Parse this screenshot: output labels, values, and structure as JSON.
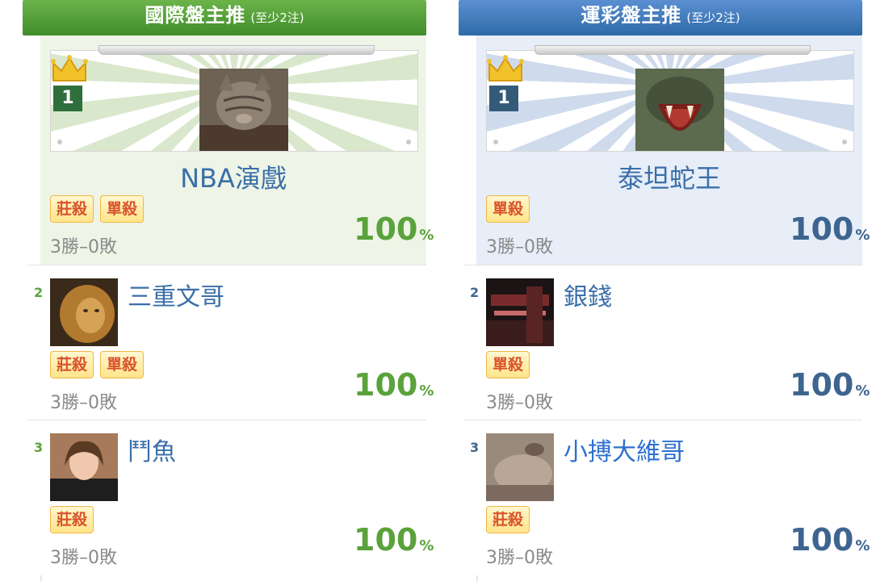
{
  "left": {
    "header": {
      "title": "國際盤主推",
      "sub": "(至少2注)"
    },
    "top": {
      "rank": "1",
      "name": "NBA演戲",
      "badges": [
        "莊殺",
        "單殺"
      ],
      "record": "3勝–0敗",
      "pct": "100",
      "pct_unit": "%"
    },
    "rows": [
      {
        "rank": "2",
        "name": "三重文哥",
        "badges": [
          "莊殺",
          "單殺"
        ],
        "record": "3勝–0敗",
        "pct": "100",
        "pct_unit": "%"
      },
      {
        "rank": "3",
        "name": "鬥魚",
        "badges": [
          "莊殺"
        ],
        "record": "3勝–0敗",
        "pct": "100",
        "pct_unit": "%"
      }
    ],
    "colors": {
      "header": "#4c9a34",
      "pct": "#5aa23b",
      "card_bg": "#eef4e6"
    }
  },
  "right": {
    "header": {
      "title": "運彩盤主推",
      "sub": "(至少2注)"
    },
    "top": {
      "rank": "1",
      "name": "泰坦蛇王",
      "badges": [
        "單殺"
      ],
      "record": "3勝–0敗",
      "pct": "100",
      "pct_unit": "%"
    },
    "rows": [
      {
        "rank": "2",
        "name": "銀錢",
        "badges": [
          "單殺"
        ],
        "record": "3勝–0敗",
        "pct": "100",
        "pct_unit": "%"
      },
      {
        "rank": "3",
        "name": "小搏大維哥",
        "badges": [
          "莊殺"
        ],
        "record": "3勝–0敗",
        "pct": "100",
        "pct_unit": "%"
      }
    ],
    "colors": {
      "header": "#3d75b5",
      "pct": "#3e6590",
      "card_bg": "#e7eef8"
    }
  }
}
